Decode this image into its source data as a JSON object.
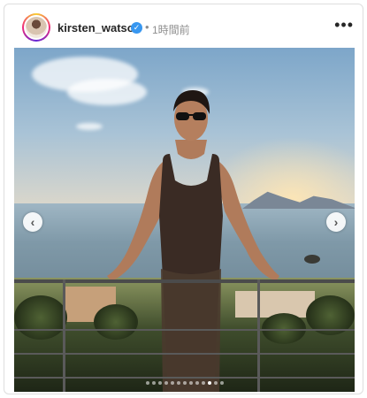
{
  "post": {
    "username": "kirsten_watson",
    "verified_mark": "✓",
    "separator": "•",
    "time_ago": "1時間前",
    "more_icon": "•••"
  },
  "carousel": {
    "prev_icon": "‹",
    "next_icon": "›",
    "slide_count": 13,
    "active_index": 10
  },
  "colors": {
    "verified": "#3897f0",
    "username": "#262626",
    "muted": "#8e8e8e"
  }
}
